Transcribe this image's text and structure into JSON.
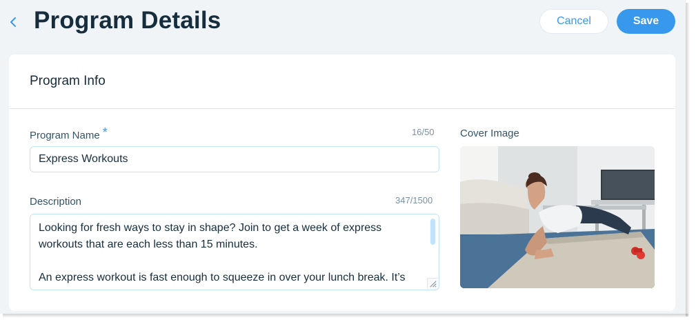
{
  "header": {
    "title": "Program Details",
    "cancel_label": "Cancel",
    "save_label": "Save"
  },
  "card": {
    "title": "Program Info"
  },
  "program_name": {
    "label": "Program Name",
    "required_mark": "*",
    "counter": "16/50",
    "value": "Express Workouts"
  },
  "description": {
    "label": "Description",
    "counter": "347/1500",
    "paragraphs": [
      "Looking for fresh ways to stay in shape? Join to get a week of express workouts that are each less than 15 minutes.",
      "An express workout is fast enough to squeeze in over your lunch break. It’s"
    ]
  },
  "cover_image": {
    "label": "Cover Image"
  },
  "colors": {
    "accent": "#3899ec",
    "page_bg": "#f0f4f7",
    "text_primary": "#162d3d",
    "input_border": "#c1e4fe"
  },
  "icons": {
    "back": "chevron-left-icon",
    "resize": "resize-handle-icon"
  }
}
